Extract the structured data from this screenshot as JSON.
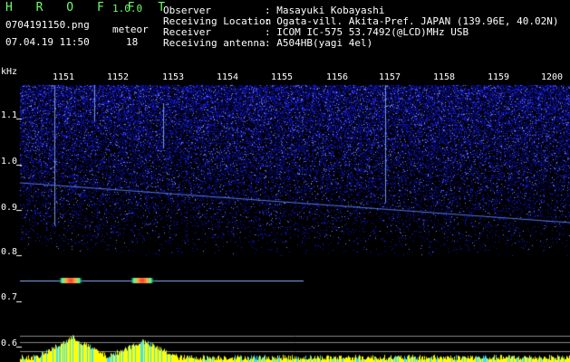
{
  "header": {
    "app_title": "H R O F F T",
    "version": "1.0.0",
    "filename": "0704191150.png",
    "datetime": "07.04.19 11:50",
    "meteor_label": "meteor",
    "meteor_count": "18",
    "fields": [
      {
        "label": "Observer",
        "value": ": Masayuki Kobayashi"
      },
      {
        "label": "Receiving Location",
        "value": ": Ogata-vill. Akita-Pref. JAPAN (139.96E, 40.02N)"
      },
      {
        "label": "Receiver",
        "value": ": ICOM IC-575 53.7492(@LCD)MHz USB"
      },
      {
        "label": "Receiving antenna",
        "value": ": A504HB(yagi 4el)"
      }
    ]
  },
  "axes": {
    "y_unit": "kHz",
    "y_ticks": [
      "1.1",
      "1.0",
      "0.9",
      "0.8",
      "0.7",
      "0.6"
    ],
    "x_ticks": [
      "1151",
      "1152",
      "1153",
      "1154",
      "1155",
      "1156",
      "1157",
      "1158",
      "1159",
      "1200"
    ]
  },
  "colors": {
    "background": "#000000",
    "noise": "#1a2aa8",
    "signal_line": "#8ab4ff",
    "carrier": "#ff4040",
    "level": "#ffff00",
    "header_green": "#6cff6c"
  }
}
